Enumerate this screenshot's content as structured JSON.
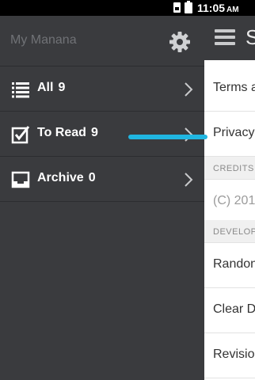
{
  "status_bar": {
    "time": "11:05",
    "ampm": "AM"
  },
  "drawer": {
    "title": "My Manana",
    "items": [
      {
        "label": "All",
        "count": "9",
        "icon": "list-icon"
      },
      {
        "label": "To Read",
        "count": "9",
        "icon": "checkbox-icon"
      },
      {
        "label": "Archive",
        "count": "0",
        "icon": "inbox-tray-icon"
      }
    ]
  },
  "main": {
    "header_title_partial": "S",
    "rows": [
      {
        "kind": "row",
        "text": "Terms a"
      },
      {
        "kind": "row",
        "text": "Privacy"
      },
      {
        "kind": "section",
        "text": "CREDITS"
      },
      {
        "kind": "row",
        "text": "(C) 201:"
      },
      {
        "kind": "section",
        "text": "DEVELOPE"
      },
      {
        "kind": "row",
        "text": "Randon"
      },
      {
        "kind": "row",
        "text": "Clear D"
      },
      {
        "kind": "row",
        "text": "Revisio"
      }
    ]
  },
  "colors": {
    "drawer_bg": "#3a3b3e",
    "accent_swipe": "#20b6e1",
    "text_white": "#ffffff",
    "text_muted": "#707276"
  }
}
